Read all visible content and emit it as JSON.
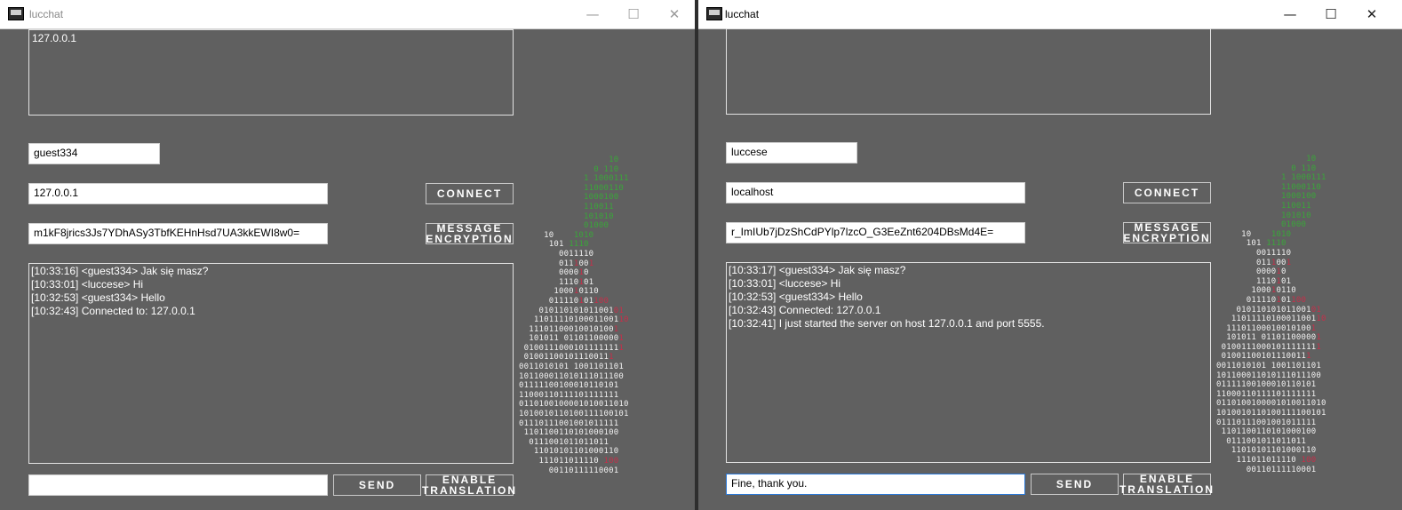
{
  "left": {
    "title": "lucchat",
    "controls": {
      "minimize": "—",
      "maximize": "☐",
      "close": "✕"
    },
    "peer_box": "127.0.0.1",
    "nick": "guest334",
    "host": "127.0.0.1",
    "key": "m1kF8jrics3Js7YDhASy3TbfKEHnHsd7UA3kkEWI8w0=",
    "connect_label": "CONNECT",
    "encryption_label_1": "MESSAGE",
    "encryption_label_2": "ENCRYPTION",
    "messages": [
      "[10:33:16] <guest334> Jak się masz?",
      "[10:33:01]  <luccese> Hi",
      "[10:32:53]  <guest334> Hello",
      "[10:32:43]  Connected to: 127.0.0.1"
    ],
    "input_value": "",
    "send_label": "SEND",
    "translation_label_1": "ENABLE",
    "translation_label_2": "TRANSLATION"
  },
  "right": {
    "title": "lucchat",
    "controls": {
      "minimize": "—",
      "maximize": "☐",
      "close": "✕"
    },
    "peer_box": "",
    "nick": "luccese",
    "host": "localhost",
    "key": "r_ImIUb7jDzShCdPYlp7lzcO_G3EeZnt6204DBsMd4E=",
    "connect_label": "CONNECT",
    "encryption_label_1": "MESSAGE",
    "encryption_label_2": "ENCRYPTION",
    "messages": [
      "[10:33:17] <guest334> Jak się masz?",
      "[10:33:01]  <luccese> Hi",
      "[10:32:53]  <guest334> Hello",
      "[10:32:43]  Connected: 127.0.0.1",
      "[10:32:41]  I just started the server on host 127.0.0.1 and port 5555."
    ],
    "input_value": "Fine, thank you.",
    "send_label": "SEND",
    "translation_label_1": "ENABLE",
    "translation_label_2": "TRANSLATION"
  },
  "colors": {
    "background": "#606060",
    "titlebar": "#ffffff",
    "art_green": "#3aa63a",
    "art_red": "#c4304a"
  }
}
